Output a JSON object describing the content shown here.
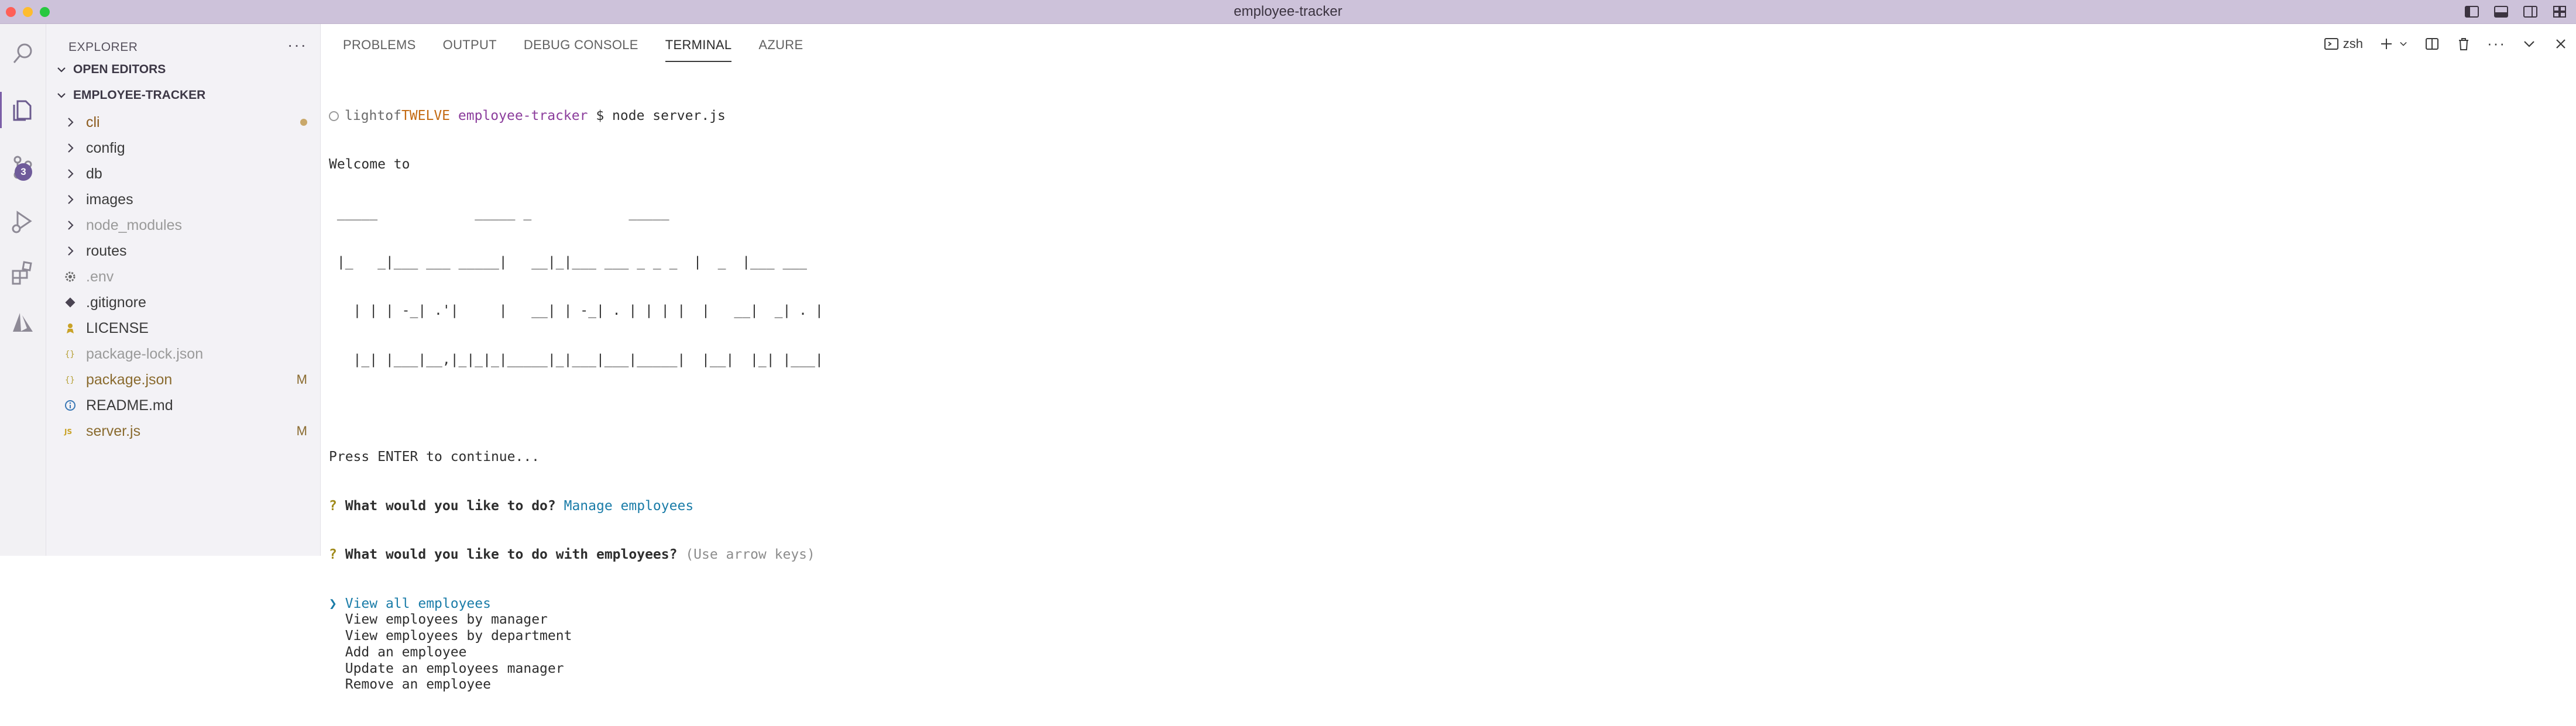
{
  "window": {
    "title": "employee-tracker"
  },
  "sidebar": {
    "header": "EXPLORER",
    "open_editors": "OPEN EDITORS",
    "project": "EMPLOYEE-TRACKER",
    "source_control_badge": "3",
    "items": [
      {
        "label": "cli",
        "type": "folder",
        "style": "folder",
        "marker": "dot"
      },
      {
        "label": "config",
        "type": "folder",
        "style": "normal",
        "marker": ""
      },
      {
        "label": "db",
        "type": "folder",
        "style": "normal",
        "marker": ""
      },
      {
        "label": "images",
        "type": "folder",
        "style": "normal",
        "marker": ""
      },
      {
        "label": "node_modules",
        "type": "folder",
        "style": "dim",
        "marker": ""
      },
      {
        "label": "routes",
        "type": "folder",
        "style": "normal",
        "marker": ""
      },
      {
        "label": ".env",
        "type": "gear",
        "style": "dim",
        "marker": ""
      },
      {
        "label": ".gitignore",
        "type": "git",
        "style": "normal",
        "marker": ""
      },
      {
        "label": "LICENSE",
        "type": "license",
        "style": "normal",
        "marker": ""
      },
      {
        "label": "package-lock.json",
        "type": "json",
        "style": "dim",
        "marker": ""
      },
      {
        "label": "package.json",
        "type": "json",
        "style": "mod",
        "marker": "M"
      },
      {
        "label": "README.md",
        "type": "info",
        "style": "normal",
        "marker": ""
      },
      {
        "label": "server.js",
        "type": "js",
        "style": "mod",
        "marker": "M"
      }
    ]
  },
  "panel": {
    "tabs": [
      "PROBLEMS",
      "OUTPUT",
      "DEBUG CONSOLE",
      "TERMINAL",
      "AZURE"
    ],
    "active_tab": "TERMINAL",
    "shell": "zsh"
  },
  "terminal": {
    "prompt_user": "lightof",
    "prompt_host": "TWELVE",
    "prompt_dir": "employee-tracker",
    "prompt_symbol": "$",
    "command": "node server.js",
    "welcome": "Welcome to",
    "ascii_art": [
      " _____            _____ _            _____",
      " |_   _|___ ___ _____|   __|_|___ ___ _ _ _  |  _  |___ ___",
      "   | | | -_| .'|     |   __| | -_| . | | | |  |   __|  _| . |",
      "   |_| |___|__,|_|_|_|_____|_|___|___|_____|  |__|  |_| |___|"
    ],
    "press_enter": "Press ENTER to continue...",
    "q1_prefix": "?",
    "q1": "What would you like to do?",
    "q1_answer": "Manage employees",
    "q2_prefix": "?",
    "q2": "What would you like to do with employees?",
    "q2_hint": "(Use arrow keys)",
    "pointer": "❯",
    "options": [
      "View all employees",
      "View employees by manager",
      "View employees by department",
      "Add an employee",
      "Update an employees manager",
      "Remove an employee"
    ],
    "selected_index": 0
  }
}
